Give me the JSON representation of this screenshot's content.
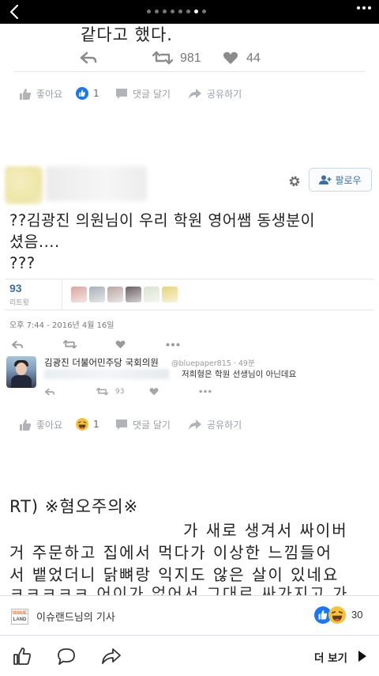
{
  "topbar": {
    "page_dots": 8,
    "active_dot": 6
  },
  "tweet1": {
    "text_fragment": "같다고 했다.",
    "retweets": "981",
    "likes": "44"
  },
  "fb_row1": {
    "like_label": "좋아요",
    "reaction_count": "1",
    "comment_label": "댓글 달기",
    "share_label": "공유하기"
  },
  "tweet2": {
    "follow_label": "팔로우",
    "text": "??김광진 의원님이 우리 학원 영어쌤 동생분이 셨음....\n???",
    "retweet_count": "93",
    "retweet_label": "리트윗",
    "date": "오후 7:44 - 2016년 4월 16일",
    "avatar_colors": [
      "#d9a6a0",
      "#a8b0b8",
      "#b9a7a3",
      "#6a5f62",
      "#d8e3cf",
      "#e8d47a"
    ]
  },
  "reply": {
    "name": "김광진 더불어민주당 국회의원",
    "handle": "@bluepaper815 · 49분",
    "text": "저희형은 학원 선생님이 아닌데요",
    "retweets": "93"
  },
  "fb_row2": {
    "like_label": "좋아요",
    "reaction_count": "1",
    "comment_label": "댓글 달기",
    "share_label": "공유하기"
  },
  "tweet3": {
    "prefix": "RT) ※혐오주의※",
    "line1": "가 새로 생겨서 싸이버",
    "line2": "거 주문하고 집에서 먹다가 이상한 느낌들어",
    "line3": "서 뱉었더니 닭뼈랑 익지도 않은 살이 있네요",
    "line4_cut": "ㅋㅋㅋㅋㅋ 어이가 없어서 그대로 싸가지고 가"
  },
  "source": {
    "logo_top": "ISSUE",
    "logo_bottom": "LAND",
    "text": "이슈랜드님의 기사",
    "reaction_count": "30"
  },
  "bottom": {
    "more_label": "더 보기"
  },
  "colors": {
    "accent": "#3a6ea5",
    "fb_blue": "#1877f2",
    "grey_icon": "#9aa0a6"
  }
}
